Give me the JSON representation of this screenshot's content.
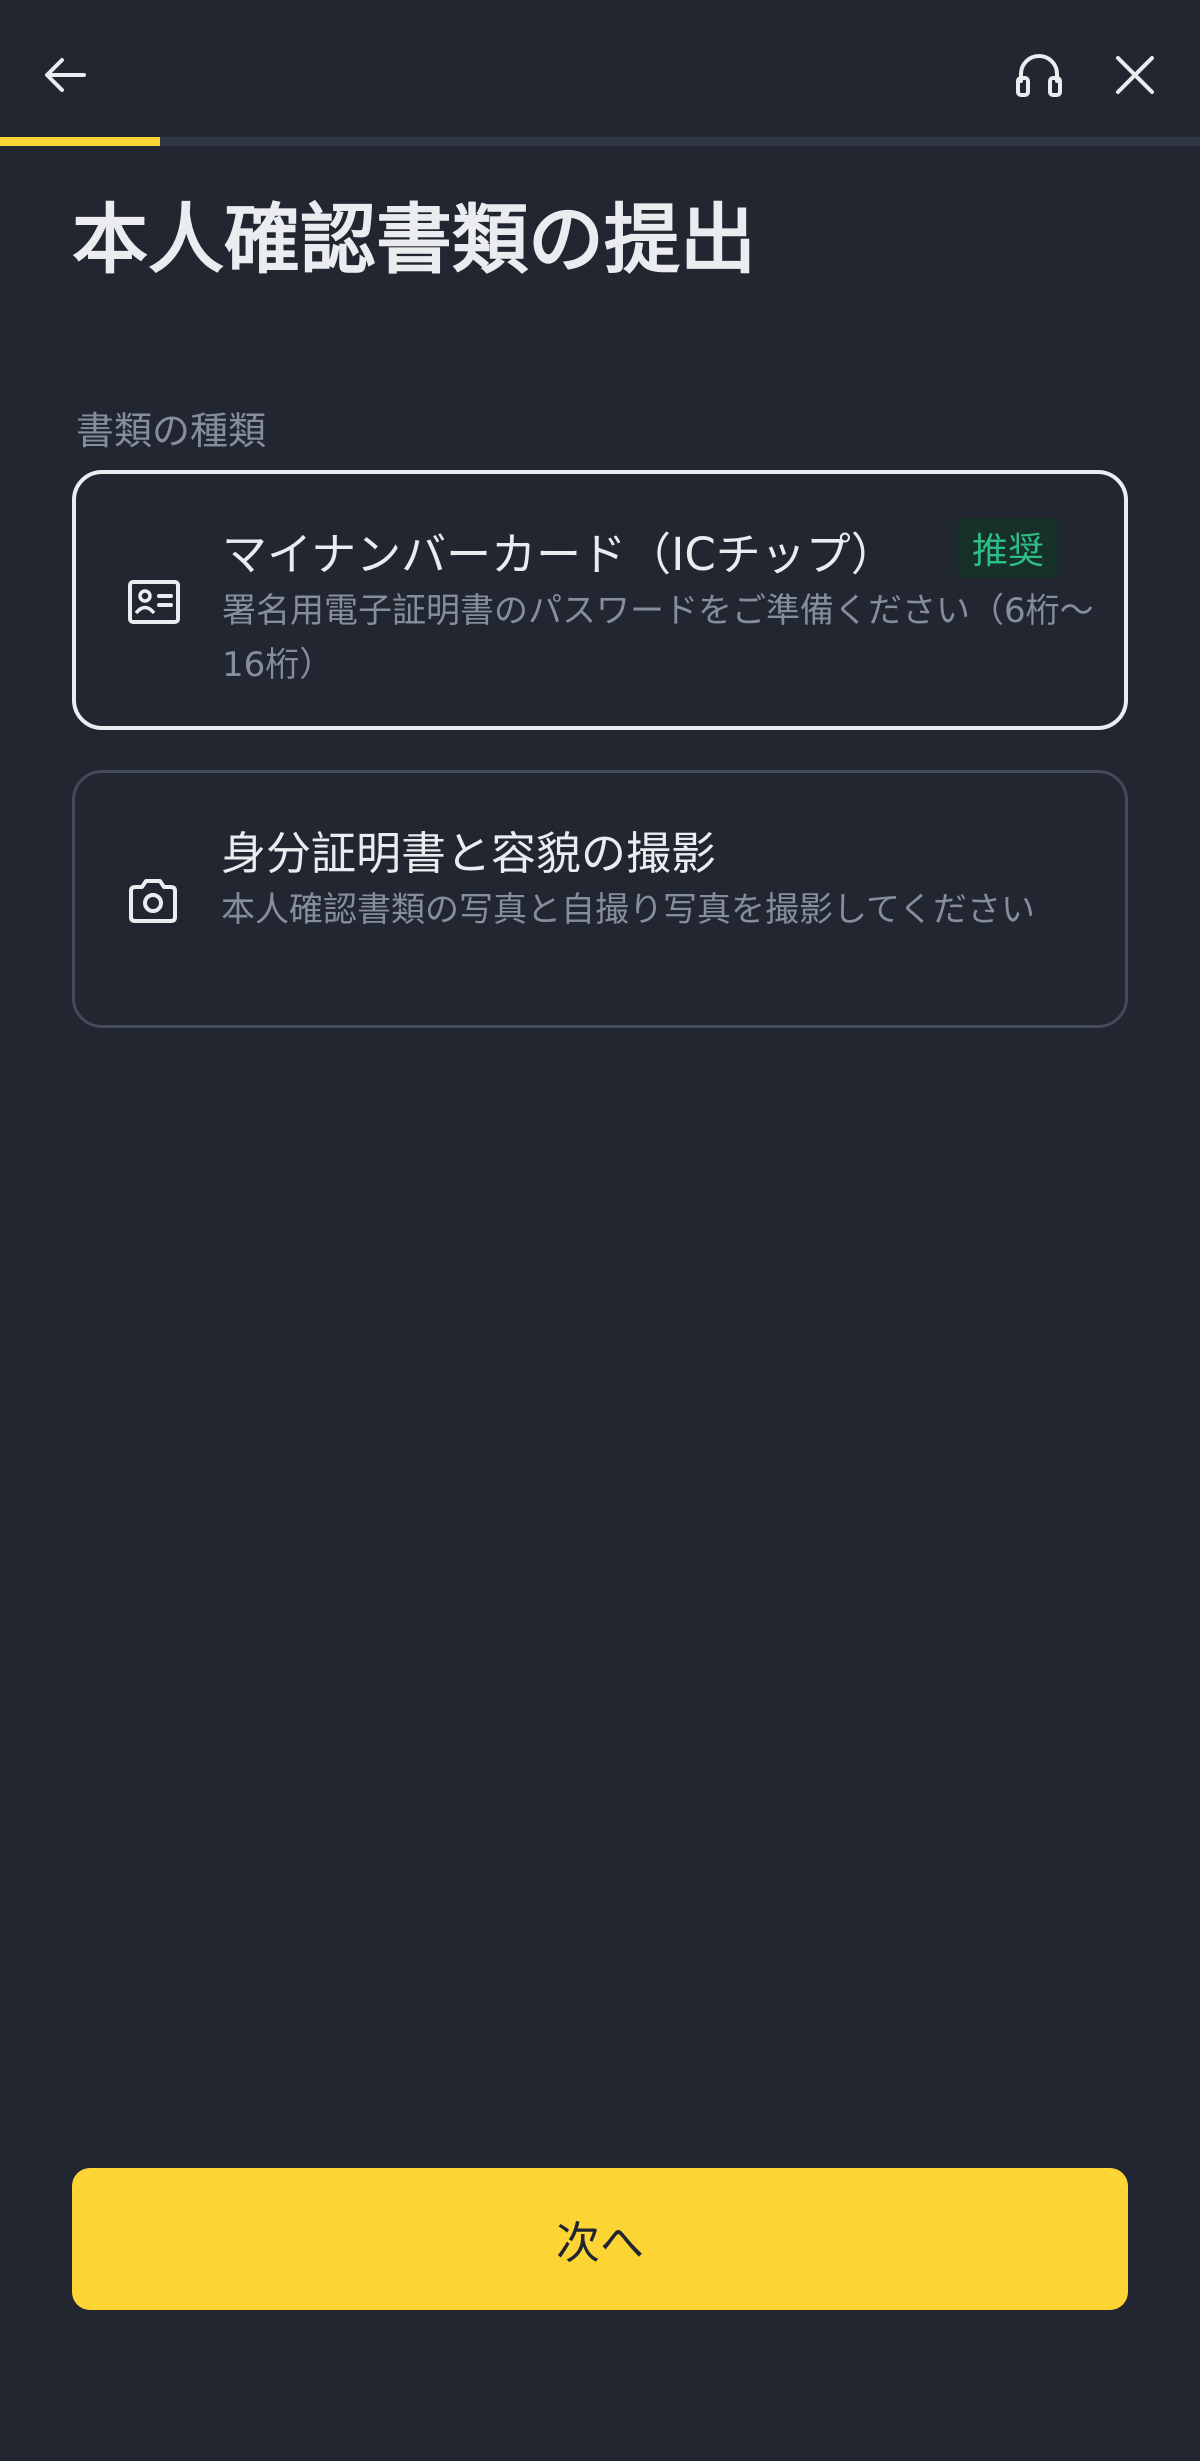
{
  "header": {
    "back_icon": "arrow-left-icon",
    "support_icon": "headset-icon",
    "close_icon": "close-icon"
  },
  "progress": {
    "fraction": 0.133
  },
  "page": {
    "title": "本人確認書類の提出",
    "section_label": "書類の種類"
  },
  "options": [
    {
      "icon": "id-card-icon",
      "title": "マイナンバーカード（ICチップ）",
      "badge": "推奨",
      "description": "署名用電子証明書のパスワードをご準備ください（6桁〜16桁）",
      "selected": true
    },
    {
      "icon": "camera-icon",
      "title": "身分証明書と容貌の撮影",
      "description": "本人確認書類の写真と自撮り写真を撮影してください",
      "selected": false
    }
  ],
  "footer": {
    "next_label": "次へ"
  },
  "colors": {
    "background": "#222631",
    "accent": "#fcd535",
    "badge_text": "#2ebd85",
    "muted_text": "#848e9c"
  }
}
